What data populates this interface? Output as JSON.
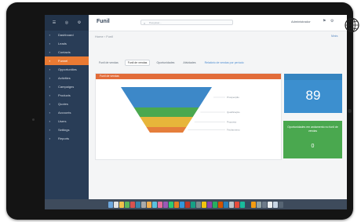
{
  "sidebar": {
    "top_icons": [
      "☰",
      "◎",
      "⚙"
    ],
    "items": [
      {
        "label": "Dashboard",
        "icon": "▪",
        "active": false
      },
      {
        "label": "Leads",
        "icon": "▪",
        "active": false
      },
      {
        "label": "Contacts",
        "icon": "▪",
        "active": false
      },
      {
        "label": "Funnel",
        "icon": "▪",
        "active": true
      },
      {
        "label": "Opportunities",
        "icon": "▪",
        "active": false
      },
      {
        "label": "Activities",
        "icon": "▪",
        "active": false
      },
      {
        "label": "Campaigns",
        "icon": "▪",
        "active": false
      },
      {
        "label": "Products",
        "icon": "▪",
        "active": false
      },
      {
        "label": "Quotes",
        "icon": "▪",
        "active": false
      },
      {
        "label": "Accounts",
        "icon": "▪",
        "active": false
      },
      {
        "label": "Users",
        "icon": "▪",
        "active": false
      },
      {
        "label": "Settings",
        "icon": "▪",
        "active": false
      },
      {
        "label": "Reports",
        "icon": "▪",
        "active": false
      }
    ]
  },
  "topbar": {
    "title": "Funil",
    "search_placeholder": "Pesquisar...",
    "user": "Administrador",
    "icons": "⚑ ⚙"
  },
  "breadcrumb": "Home › Funil",
  "more_link": "Mais",
  "tabs": [
    {
      "label": "Funil de vendas",
      "selected": false,
      "link": false
    },
    {
      "label": "Funil de vendas",
      "selected": true,
      "link": false
    },
    {
      "label": "Oportunidades",
      "selected": false,
      "link": false
    },
    {
      "label": "Atividades",
      "selected": false,
      "link": false
    },
    {
      "label": "Relatório de vendas por período",
      "selected": false,
      "link": true
    }
  ],
  "panel": {
    "header": "Funil de vendas",
    "funnel": [
      {
        "color": "#3d88c8",
        "label": "Prospecção"
      },
      {
        "color": "#4aa84f",
        "label": "Qualificação"
      },
      {
        "color": "#e7b53a",
        "label": "Proposta"
      },
      {
        "color": "#e57e3b",
        "label": "Fechamento"
      }
    ]
  },
  "stat_card": {
    "value": "89",
    "color": "#3c8fcf"
  },
  "green_card": {
    "text": "Oportunidades em andamento no funil de vendas",
    "value": "0",
    "color": "#4aa84f"
  },
  "dock_colors": [
    "#6ea8de",
    "#e2e2e2",
    "#f0c14b",
    "#5db85c",
    "#d9534f",
    "#3a87ad",
    "#aaaaaa",
    "#f0ad4e",
    "#5bc0de",
    "#e86c9c",
    "#9b59b6",
    "#2ecc71",
    "#e67e22",
    "#3498db",
    "#c0392b",
    "#16a085",
    "#7f8c8d",
    "#f1c40f",
    "#8e44ad",
    "#27ae60",
    "#d35400",
    "#2980b9",
    "#bdc3c7",
    "#e74c3c",
    "#1abc9c",
    "#34495e",
    "#f39c12",
    "#95a5a6",
    "#6c7a89",
    "#ecf0f1",
    "#c8d6e5",
    "#576574"
  ]
}
